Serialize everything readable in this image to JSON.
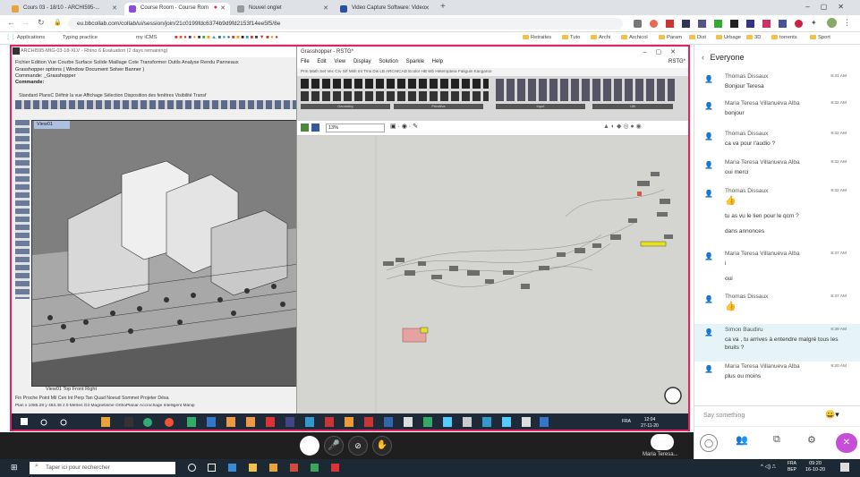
{
  "browser": {
    "tabs": [
      {
        "label": "Cours 03 - 18/10 - ARCHI595-...",
        "icon_color": "#e8a33a"
      },
      {
        "label": "Course Room - Course Rom",
        "icon_color": "#8a4fd6"
      },
      {
        "label": "Nouvel onglet",
        "icon_color": "#999999"
      },
      {
        "label": "Video Capture Software: Video",
        "icon_color": "#2a4fa0"
      }
    ],
    "url": "eu.bbcollab.com/collab/ui/session/join/21c0199fdc6374b9d9fd2153f14ee5f5/8e",
    "bookmarks": [
      "Applications",
      "Typing practice",
      "my iCMS",
      "Retraites",
      "Tuto",
      "Archi",
      "Archicol",
      "Param",
      "Dist",
      "Urbage",
      "3D",
      "torrents",
      "Sport"
    ]
  },
  "rhino": {
    "title": "ARCHI595-MIG-03-18-XLV - Rhino 6 Evaluation (2 days remaining)",
    "menu": "Fichier  Édition  Vue  Courbe  Surface  Solide  Maillage  Cote  Transformer  Outils  Analyse  Rendu  Panneaux",
    "gh_options": "Grasshopper options ( Window  Document  Solver  Banner )",
    "command1": "Commande: _Grasshopper",
    "command2": "Commande:",
    "toolbar_tabs": "Standard  PlansC  Définir la vue  Affichage  Sélection  Disposition des fenêtres  Visibilité  Transf",
    "viewport_label": "View01",
    "view_tabs": "View01   Top   Front   Right",
    "osnaps": "Fin  Proche  Point  Mil  Cen  Int  Perp  Tan  Quad  Noeud  Sommet  Projeter  Désa",
    "status": "Plan x 1085.28  y 453.46   z 0    Mètres    G3          Magnétisme  OrthoPlanar  Accrochage Intelligent  Manip"
  },
  "grasshopper": {
    "title": "Grasshopper - RSTG*",
    "menu": [
      "File",
      "Edit",
      "View",
      "Display",
      "Solution",
      "Sparkle",
      "Help"
    ],
    "doc_name": "RSTG*",
    "tabs": "Prm  Math  Set  Vec  Crv  Srf  Msh  Int  Trns  Dis  LB  ARCHICAD  Ecolor  HB  Wb  Heteroptera  Fatiguin  Kangaroo",
    "groups": [
      "Geometry",
      "Primitive",
      "Input",
      "Util"
    ],
    "zoom": "13%"
  },
  "taskbar_inner": {
    "time": "12:04",
    "date": "27-11-20",
    "lang": "FRA"
  },
  "meeting": {
    "presenter_name": "Maria Teresa..."
  },
  "chat": {
    "title": "Everyone",
    "messages": [
      {
        "name": "Thomas Dissaux",
        "time": "8:31 AM",
        "lines": [
          "Bonjour Teresa"
        ]
      },
      {
        "name": "Maria Teresa Villanueva Alba",
        "time": "8:32 AM",
        "lines": [
          "bonjour"
        ]
      },
      {
        "name": "Thomas Dissaux",
        "time": "8:32 AM",
        "lines": [
          "ca va pour l'audio ?"
        ]
      },
      {
        "name": "Maria Teresa Villanueva Alba",
        "time": "8:32 AM",
        "lines": [
          "oui merci"
        ]
      },
      {
        "name": "Thomas Dissaux",
        "time": "8:32 AM",
        "lines": [
          "👍",
          "tu as vu le lien pour le qcm ?",
          "dans annonces"
        ]
      },
      {
        "name": "Maria Teresa Villanueva Alba",
        "time": "8:37 AM",
        "lines": [
          "i",
          "oui"
        ]
      },
      {
        "name": "Thomas Dissaux",
        "time": "8:37 AM",
        "lines": [
          "👍"
        ]
      },
      {
        "name": "Simon Baudiru",
        "time": "8:39 AM",
        "lines": [
          "ca va , tu arrives à entendre malgré tous les bruits ?"
        ]
      },
      {
        "name": "Maria Teresa Villanueva Alba",
        "time": "9:20 AM",
        "lines": [
          "plus ou moins"
        ]
      }
    ],
    "input_placeholder": "Say something"
  },
  "windows": {
    "search_placeholder": "Taper ici pour rechercher",
    "lang": "FRA",
    "lang2": "BEP",
    "time": "09:20",
    "date": "16-10-20"
  },
  "colors": {
    "share_border": "#e0245e",
    "chat_accent": "#e6f4f8",
    "collab_purple": "#c64dd6"
  }
}
